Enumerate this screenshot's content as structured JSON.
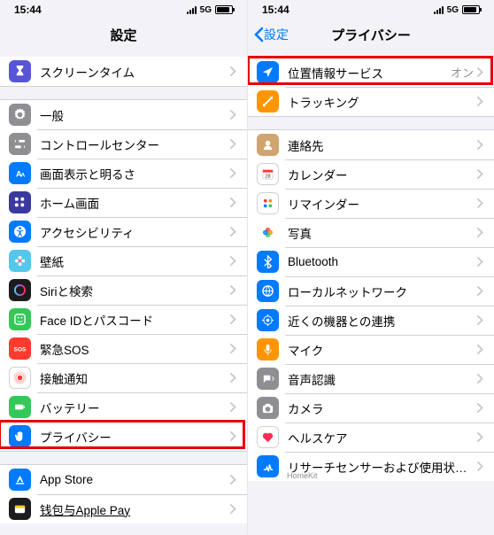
{
  "status": {
    "time": "15:44",
    "network": "5G"
  },
  "left": {
    "title": "設定",
    "back": null,
    "sections": [
      {
        "partialTop": true,
        "rows": [
          {
            "id": "screen-time",
            "label": "スクリーンタイム",
            "icon": "hourglass",
            "color": "#5856d6"
          }
        ]
      },
      {
        "rows": [
          {
            "id": "general",
            "label": "一般",
            "icon": "gear",
            "color": "#8e8e93"
          },
          {
            "id": "control-center",
            "label": "コントロールセンター",
            "icon": "switches",
            "color": "#8e8e93"
          },
          {
            "id": "display",
            "label": "画面表示と明るさ",
            "icon": "text-size",
            "color": "#007aff"
          },
          {
            "id": "home-screen",
            "label": "ホーム画面",
            "icon": "grid",
            "color": "#3a3a9e"
          },
          {
            "id": "accessibility",
            "label": "アクセシビリティ",
            "icon": "accessibility",
            "color": "#007aff"
          },
          {
            "id": "wallpaper",
            "label": "壁紙",
            "icon": "flower",
            "color": "#54c7ec"
          },
          {
            "id": "siri",
            "label": "Siriと検索",
            "icon": "siri",
            "color": "#1c1c1e"
          },
          {
            "id": "faceid",
            "label": "Face IDとパスコード",
            "icon": "faceid",
            "color": "#34c759"
          },
          {
            "id": "sos",
            "label": "緊急SOS",
            "icon": "sos",
            "color": "#ff3b30"
          },
          {
            "id": "exposure",
            "label": "接触通知",
            "icon": "exposure",
            "color": "#ffffff",
            "border": true
          },
          {
            "id": "battery",
            "label": "バッテリー",
            "icon": "battery",
            "color": "#34c759"
          },
          {
            "id": "privacy",
            "label": "プライバシー",
            "icon": "hand",
            "color": "#007aff",
            "highlight": true
          }
        ]
      },
      {
        "partialBottom": true,
        "rows": [
          {
            "id": "app-store",
            "label": "App Store",
            "icon": "appstore",
            "color": "#007aff"
          },
          {
            "id": "wallet",
            "label": "钱包与Apple Pay",
            "icon": "wallet",
            "color": "#1c1c1e",
            "underline": true
          }
        ]
      }
    ]
  },
  "right": {
    "title": "プライバシー",
    "back": "設定",
    "sections": [
      {
        "rows": [
          {
            "id": "location",
            "label": "位置情報サービス",
            "icon": "location",
            "color": "#007aff",
            "value": "オン",
            "highlight": true
          },
          {
            "id": "tracking",
            "label": "トラッキング",
            "icon": "tracking",
            "color": "#ff9500"
          }
        ]
      },
      {
        "partialBottom": true,
        "rows": [
          {
            "id": "contacts",
            "label": "連絡先",
            "icon": "contacts",
            "color": "#d1a36f"
          },
          {
            "id": "calendar",
            "label": "カレンダー",
            "icon": "calendar",
            "color": "#ffffff",
            "border": true
          },
          {
            "id": "reminders",
            "label": "リマインダー",
            "icon": "reminders",
            "color": "#ffffff",
            "border": true
          },
          {
            "id": "photos",
            "label": "写真",
            "icon": "photos",
            "color": "#ffffff"
          },
          {
            "id": "bluetooth",
            "label": "Bluetooth",
            "icon": "bluetooth",
            "color": "#007aff"
          },
          {
            "id": "local-network",
            "label": "ローカルネットワーク",
            "icon": "network",
            "color": "#007aff"
          },
          {
            "id": "nearby",
            "label": "近くの機器との連携",
            "icon": "nearby",
            "color": "#007aff"
          },
          {
            "id": "microphone",
            "label": "マイク",
            "icon": "mic",
            "color": "#ff9500"
          },
          {
            "id": "speech",
            "label": "音声認識",
            "icon": "speech",
            "color": "#8e8e93"
          },
          {
            "id": "camera",
            "label": "カメラ",
            "icon": "camera",
            "color": "#8e8e93"
          },
          {
            "id": "health",
            "label": "ヘルスケア",
            "icon": "health",
            "color": "#ffffff",
            "border": true
          },
          {
            "id": "research",
            "label": "リサーチセンサーおよび使用状況データ",
            "icon": "research",
            "color": "#007aff",
            "sub": "HomeKit"
          }
        ]
      }
    ]
  }
}
